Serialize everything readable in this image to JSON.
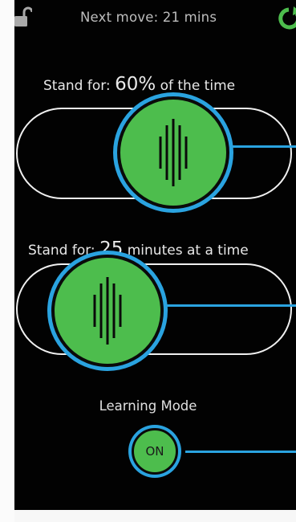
{
  "header": {
    "next_move_label": "Next move:",
    "next_move_value": "21 mins"
  },
  "stand_percent": {
    "prefix": "Stand for:",
    "value": "60%",
    "suffix": "of the time"
  },
  "stand_minutes": {
    "prefix": "Stand for:",
    "value": "25",
    "suffix": "minutes at a time"
  },
  "learning_mode": {
    "label": "Learning Mode",
    "button_label": "ON"
  },
  "icons": {
    "lock": "unlocked-padlock-icon",
    "refresh": "refresh-icon",
    "grip": "slider-grip-icon"
  },
  "colors": {
    "background": "#020202",
    "accent_green": "#4dbd4d",
    "highlight_blue": "#2aa3e0",
    "track_outline": "#f0f0f0",
    "text": "#e8e8e8"
  }
}
